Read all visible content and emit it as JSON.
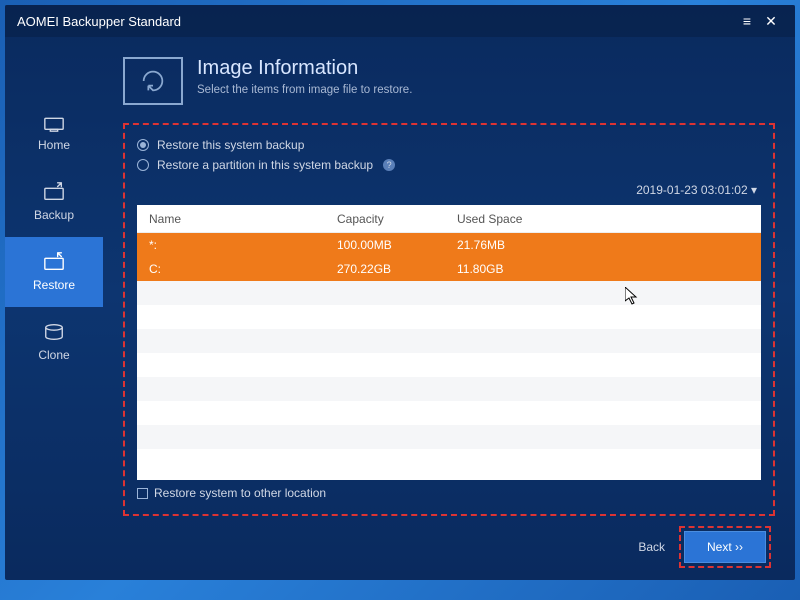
{
  "titlebar": {
    "title": "AOMEI Backupper Standard"
  },
  "sidebar": {
    "items": [
      {
        "label": "Home"
      },
      {
        "label": "Backup"
      },
      {
        "label": "Restore"
      },
      {
        "label": "Clone"
      }
    ]
  },
  "header": {
    "title": "Image Information",
    "subtitle": "Select the items from image file to restore."
  },
  "options": {
    "opt1": "Restore this system backup",
    "opt2": "Restore a partition in this system backup"
  },
  "timestamp": "2019-01-23 03:01:02 ▾",
  "table": {
    "headers": {
      "name": "Name",
      "capacity": "Capacity",
      "used": "Used Space"
    },
    "rows": [
      {
        "name": "*:",
        "capacity": "100.00MB",
        "used": "21.76MB"
      },
      {
        "name": "C:",
        "capacity": "270.22GB",
        "used": "11.80GB"
      }
    ]
  },
  "checkbox": {
    "label": "Restore system to other location"
  },
  "footer": {
    "back": "Back",
    "next": "Next ››"
  }
}
